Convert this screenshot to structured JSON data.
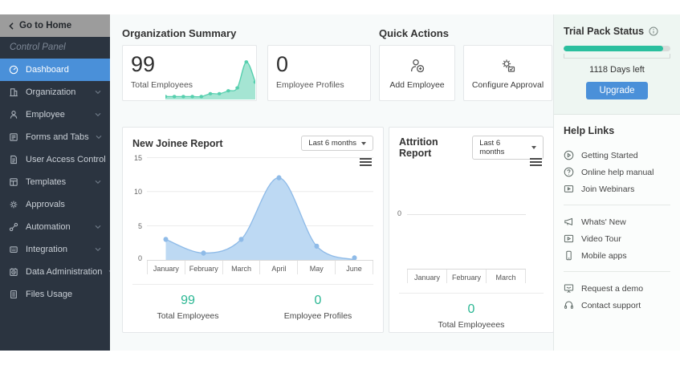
{
  "sidebar": {
    "back_label": "Go to Home",
    "panel_label": "Control Panel",
    "items": [
      {
        "label": "Dashboard",
        "icon": "gauge",
        "active": true,
        "expandable": false
      },
      {
        "label": "Organization",
        "icon": "building",
        "expandable": true
      },
      {
        "label": "Employee",
        "icon": "person",
        "expandable": true
      },
      {
        "label": "Forms and Tabs",
        "icon": "form",
        "expandable": true
      },
      {
        "label": "User Access Control",
        "icon": "document",
        "expandable": true
      },
      {
        "label": "Templates",
        "icon": "template",
        "expandable": true
      },
      {
        "label": "Approvals",
        "icon": "gear",
        "expandable": false
      },
      {
        "label": "Automation",
        "icon": "link-nodes",
        "expandable": true
      },
      {
        "label": "Integration",
        "icon": "integration-box",
        "expandable": true
      },
      {
        "label": "Data Administration",
        "icon": "data-clock",
        "expandable": true
      },
      {
        "label": "Files Usage",
        "icon": "file",
        "expandable": false
      }
    ]
  },
  "org_summary": {
    "title": "Organization Summary",
    "total_employees": {
      "value": "99",
      "label": "Total Employees"
    },
    "employee_profiles": {
      "value": "0",
      "label": "Employee Profiles"
    }
  },
  "quick_actions": {
    "title": "Quick Actions",
    "add_employee": "Add Employee",
    "configure_approval": "Configure Approval"
  },
  "trial_pack": {
    "title": "Trial Pack Status",
    "days_left": "1118 Days left",
    "upgrade_label": "Upgrade",
    "progress_percent": 93,
    "fill_color": "#2abf9e",
    "button_color": "#4a90d9"
  },
  "help_links": {
    "title": "Help Links",
    "groups": [
      [
        {
          "label": "Getting Started",
          "icon": "play-circle"
        },
        {
          "label": "Online help manual",
          "icon": "question-circle"
        },
        {
          "label": "Join Webinars",
          "icon": "webinar-screen"
        }
      ],
      [
        {
          "label": "Whats' New",
          "icon": "megaphone"
        },
        {
          "label": "Video Tour",
          "icon": "video"
        },
        {
          "label": "Mobile apps",
          "icon": "phone"
        }
      ],
      [
        {
          "label": "Request a demo",
          "icon": "presentation"
        },
        {
          "label": "Contact support",
          "icon": "headset"
        }
      ]
    ]
  },
  "chart_data": [
    {
      "type": "area",
      "title": "New Joinee Report",
      "range_selector": "Last 6 months",
      "categories": [
        "January",
        "February",
        "March",
        "April",
        "May",
        "June"
      ],
      "values": [
        3,
        1,
        3,
        12,
        2,
        0
      ],
      "ylim": [
        0,
        15
      ],
      "yticks_display": [
        "15",
        "10",
        "5",
        "0"
      ],
      "grid": true,
      "legend": "none",
      "line_color": "#8fbbe8",
      "fill_color": "#bdd9f3",
      "footer_stats": [
        {
          "value": "99",
          "label": "Total Employees"
        },
        {
          "value": "0",
          "label": "Employee Profiles"
        }
      ]
    },
    {
      "type": "area",
      "title": "Attrition Report",
      "range_selector": "Last 6 months",
      "categories": [
        "January",
        "February",
        "March"
      ],
      "values": [
        0,
        0,
        0
      ],
      "ylim": [
        0,
        0
      ],
      "yticks_display": [
        "0"
      ],
      "grid": true,
      "legend": "none",
      "footer_stats": [
        {
          "value": "0",
          "label": "Total Employeees"
        }
      ]
    },
    {
      "type": "area-sparkline",
      "title": "Total Employees trend",
      "values": [
        1,
        1,
        1,
        1,
        1,
        2,
        2,
        3,
        4,
        13,
        6
      ],
      "ylim": [
        0,
        15
      ],
      "line_color": "#56cfae",
      "fill_color": "#a5e5d3"
    }
  ]
}
